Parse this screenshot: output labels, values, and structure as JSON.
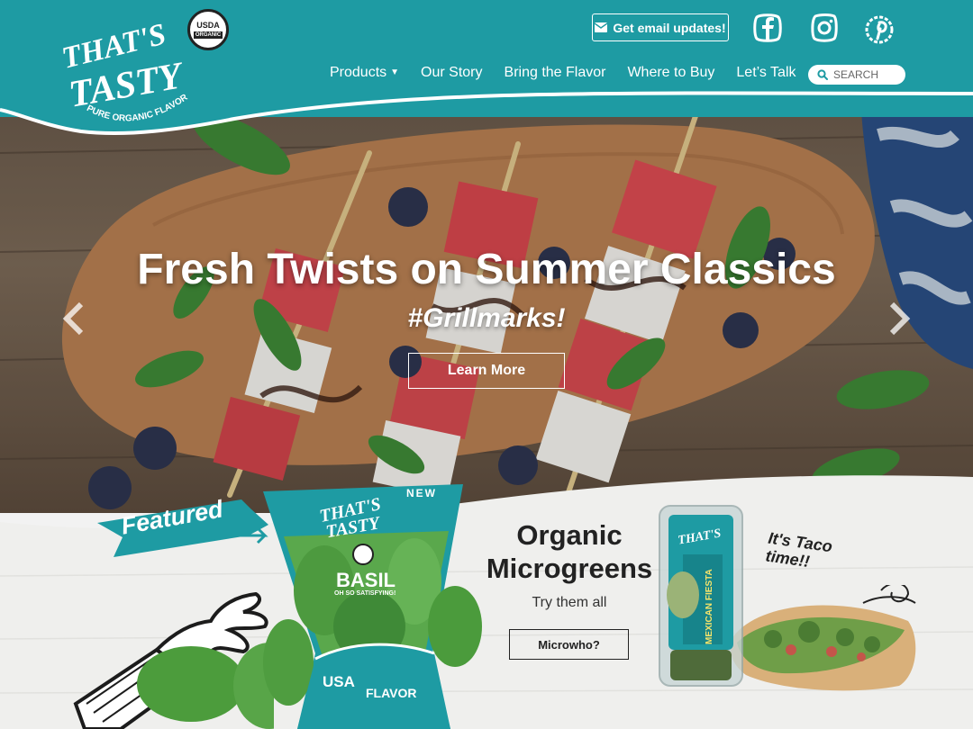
{
  "header": {
    "brand_logo_text": "THAT'S TASTY",
    "brand_tagline": "PURE ORGANIC FLAVOR",
    "usda_line1": "USDA",
    "usda_line2": "ORGANIC",
    "email_button_label": "Get email updates!",
    "nav": [
      {
        "label": "Products"
      },
      {
        "label": "Our Story"
      },
      {
        "label": "Bring the Flavor"
      },
      {
        "label": "Where to Buy"
      },
      {
        "label": "Let’s Talk"
      }
    ],
    "search_placeholder": "SEARCH",
    "social_icons": [
      "facebook-icon",
      "instagram-icon",
      "pinterest-icon"
    ]
  },
  "hero": {
    "title": "Fresh Twists on Summer Classics",
    "subtitle": "#Grillmarks!",
    "button_label": "Learn More"
  },
  "featured": {
    "banner_label": "Featured",
    "package_badge": "NEW",
    "package_name": "BASIL",
    "package_tagline": "OH SO SATISFYING!",
    "package_usa": "USA",
    "package_flavor": "FLAVOR",
    "promo_title": "Organic Microgreens",
    "promo_subtitle": "Try them all",
    "promo_button_label": "Microwho?",
    "taco_note": "It's Taco time!!"
  },
  "colors": {
    "brand_teal": "#1e9ba3",
    "white": "#ffffff",
    "dark_text": "#222222"
  }
}
